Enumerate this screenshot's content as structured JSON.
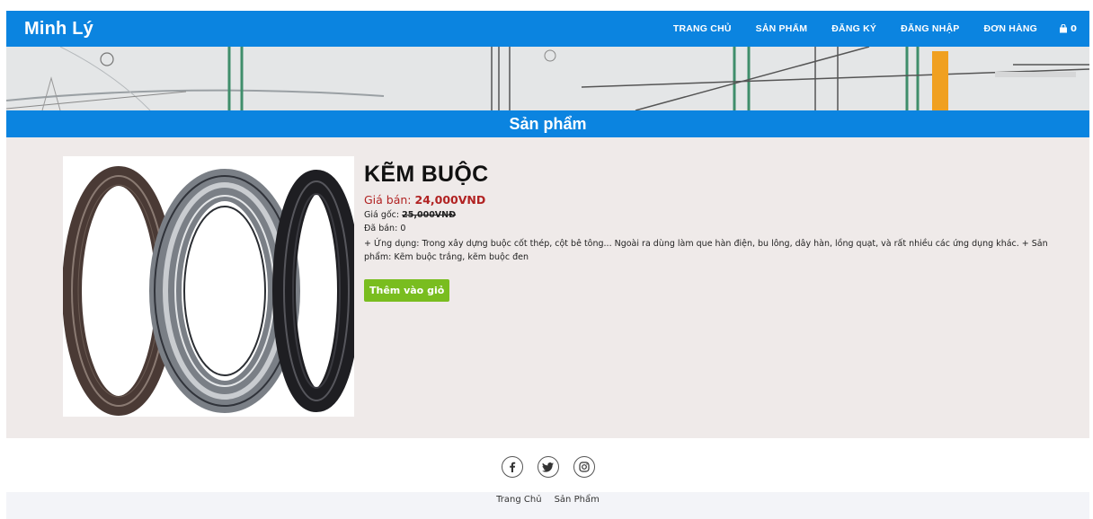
{
  "brand": "Minh Lý",
  "nav": {
    "items": [
      "TRANG CHỦ",
      "SẢN PHẨM",
      "ĐĂNG KÝ",
      "ĐĂNG NHẬP",
      "ĐƠN HÀNG"
    ],
    "cart_count": "0",
    "cart_icon": "shopping-bag-icon"
  },
  "section_title": "Sản phẩm",
  "product": {
    "name": "KẼM BUỘC",
    "price_label": "Giá bán:",
    "price_value": "24,000VND",
    "original_label": "Giá gốc:",
    "original_value": "25,000VNĐ",
    "sold_label": "Đã bán:",
    "sold_value": "0",
    "description": "+ Ứng dụng: Trong xây dựng buộc cốt thép, cột bê tông... Ngoài ra dùng làm que hàn điện, bu lông, dây hàn, lồng quạt, và rất nhiều các ứng dụng khác. + Sản phẩm: Kẽm buộc trắng, kẽm buộc đen",
    "add_to_cart": "Thêm vào giỏ"
  },
  "social": [
    "facebook-icon",
    "twitter-icon",
    "instagram-icon"
  ],
  "footer_links": [
    "Trang Chủ",
    "Sản Phẩm"
  ],
  "colors": {
    "primary": "#0b84e0",
    "price": "#b12222",
    "button": "#79bd1f",
    "product_bg": "#efeae9"
  }
}
